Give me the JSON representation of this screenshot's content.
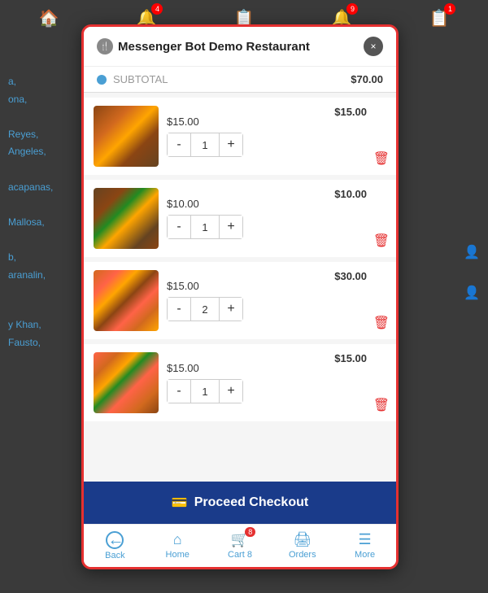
{
  "app": {
    "title": "Messenger Bot Demo Restaurant",
    "close_label": "×"
  },
  "background": {
    "nav_items": [
      {
        "icon": "🏠",
        "badge": null
      },
      {
        "icon": "🔔",
        "badge": "4"
      },
      {
        "icon": "📋",
        "badge": null
      },
      {
        "icon": "🔔",
        "badge": "9"
      },
      {
        "icon": "📋",
        "badge": "1"
      }
    ],
    "sidebar_text": [
      "a,",
      "ona,",
      "",
      "Reyes,",
      "Angeles,",
      "",
      "acapanas,",
      "",
      "Mallosa,",
      "",
      "b,",
      "aranalin,"
    ]
  },
  "subtotal": {
    "label": "SUBTOTAL",
    "amount": "$70.00"
  },
  "cart_items": [
    {
      "price": "$15.00",
      "quantity": 1,
      "total": "$15.00",
      "image_class": "burger1"
    },
    {
      "price": "$10.00",
      "quantity": 1,
      "total": "$10.00",
      "image_class": "burger2"
    },
    {
      "price": "$15.00",
      "quantity": 2,
      "total": "$30.00",
      "image_class": "pizza1"
    },
    {
      "price": "$15.00",
      "quantity": 1,
      "total": "$15.00",
      "image_class": "pizza2"
    }
  ],
  "checkout": {
    "label": "Proceed Checkout",
    "icon": "💳"
  },
  "bottom_nav": [
    {
      "label": "Back",
      "icon": "←",
      "badge": null
    },
    {
      "label": "Home",
      "icon": "🏠",
      "badge": null
    },
    {
      "label": "Cart",
      "icon": "🛒",
      "badge": "8"
    },
    {
      "label": "Orders",
      "icon": "🖨",
      "badge": null
    },
    {
      "label": "More",
      "icon": "☰",
      "badge": null
    }
  ]
}
